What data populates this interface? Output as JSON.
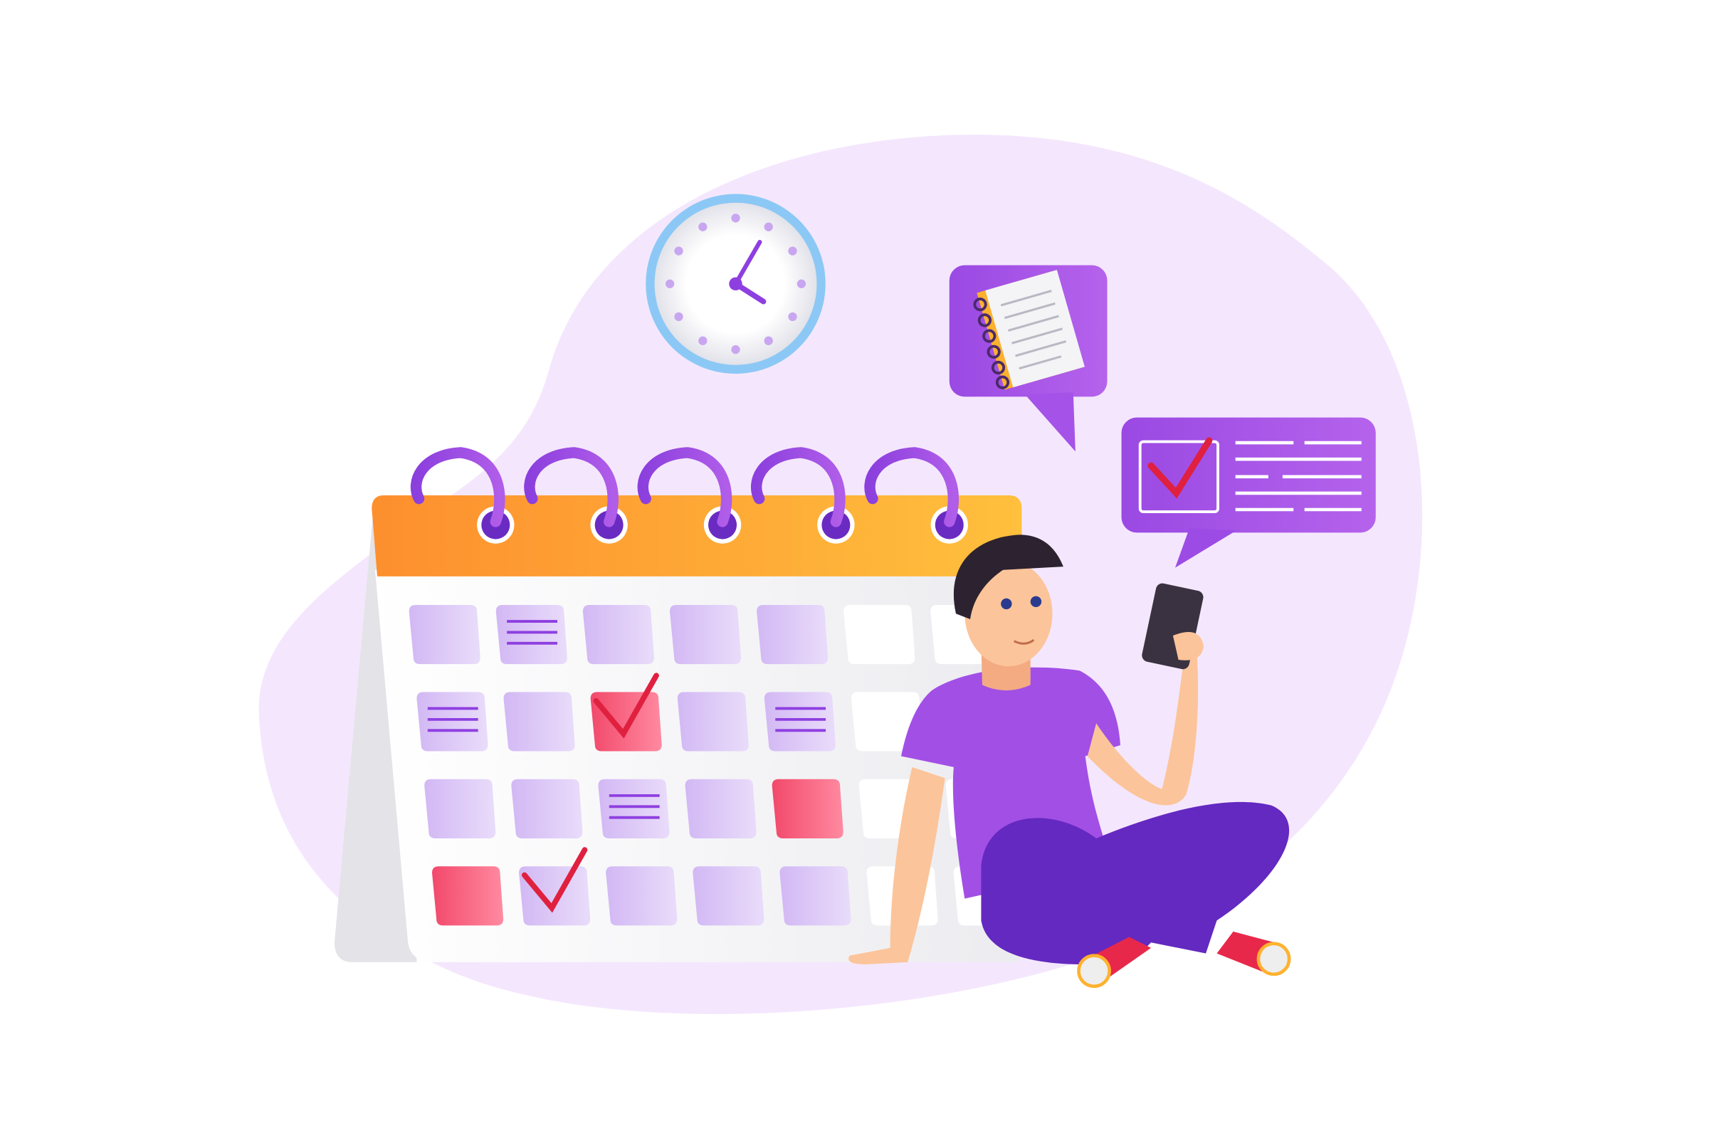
{
  "colors": {
    "background": "#ffffff",
    "blob": "#f4e7fd",
    "purple": "#8e3fe0",
    "purple_light": "#d9c4f5",
    "orange_start": "#fd8f2e",
    "orange_end": "#ffbf3c",
    "red": "#f2496b",
    "check": "#e0203f",
    "skin": "#fcc49a",
    "hair": "#2c2230",
    "pants": "#6429c0",
    "shirt": "#a24fe6"
  },
  "calendar": {
    "rings": 5,
    "rows": [
      [
        "plain",
        "lines",
        "plain",
        "plain",
        "plain",
        "white",
        "white"
      ],
      [
        "lines",
        "plain",
        "red-check",
        "plain",
        "lines",
        "white",
        "white"
      ],
      [
        "plain",
        "plain",
        "lines",
        "plain",
        "red",
        "white",
        "white"
      ],
      [
        "red",
        "plain-check",
        "plain",
        "plain",
        "plain",
        "white",
        "white"
      ]
    ]
  },
  "clock": {
    "hour": 4,
    "minute": 5
  },
  "icons": [
    "clock-icon",
    "notebook-icon",
    "checklist-icon",
    "phone-icon",
    "calendar-icon"
  ]
}
